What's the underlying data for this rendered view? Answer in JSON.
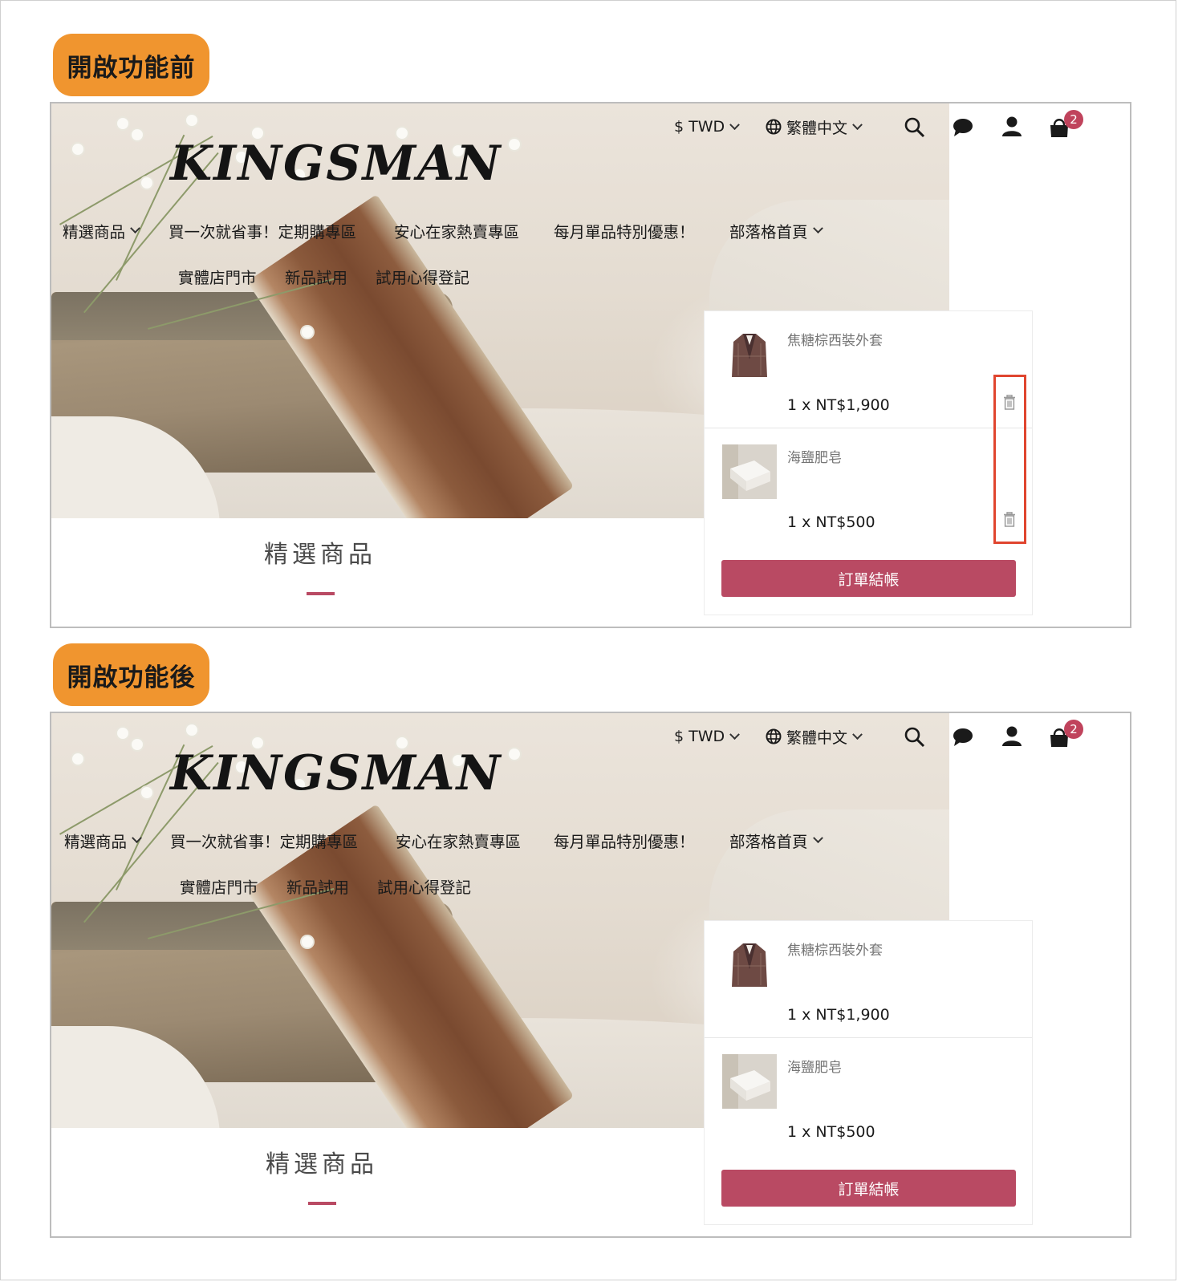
{
  "labels": {
    "before": "開啟功能前",
    "after": "開啟功能後"
  },
  "store": {
    "logo": "KINGSMAN",
    "currency": "$ TWD",
    "language": "繁體中文",
    "cart_count": "2",
    "icons": [
      "search-icon",
      "chat-icon",
      "user-icon",
      "cart-icon",
      "globe-icon"
    ]
  },
  "nav": {
    "row1": [
      {
        "label": "精選商品",
        "dropdown": true
      },
      {
        "label": "買一次就省事！定期購專區",
        "dropdown": false
      },
      {
        "label": "安心在家熱賣專區",
        "dropdown": false
      },
      {
        "label": "每月單品特別優惠！",
        "dropdown": false
      },
      {
        "label": "部落格首頁",
        "dropdown": true
      }
    ],
    "row2": [
      {
        "label": "實體店門市"
      },
      {
        "label": "新品試用"
      },
      {
        "label": "試用心得登記"
      }
    ]
  },
  "cart": {
    "items": [
      {
        "name": "焦糖棕西裝外套",
        "qty_price": "1 x  NT$1,900"
      },
      {
        "name": "海鹽肥皂",
        "qty_price": "1 x  NT$500"
      }
    ],
    "checkout_label": "訂單結帳"
  },
  "section": {
    "title": "精選商品"
  },
  "colors": {
    "label_bg": "#f0952f",
    "accent": "#b94a63",
    "highlight": "#e0452f"
  },
  "panels": [
    {
      "state": "before",
      "delete_icons_visible": true,
      "highlighted": true
    },
    {
      "state": "after",
      "delete_icons_visible": false,
      "highlighted": false
    }
  ]
}
